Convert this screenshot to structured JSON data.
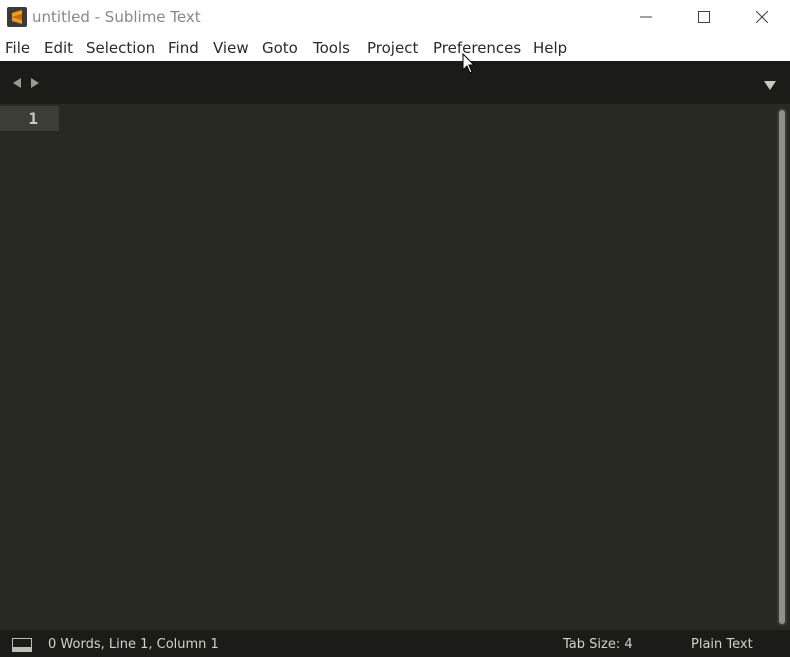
{
  "window": {
    "title": "untitled - Sublime Text",
    "app_icon": "sublime-text-logo",
    "controls": [
      "minimize-icon",
      "maximize-icon",
      "close-icon"
    ]
  },
  "menu": {
    "items": [
      {
        "label": "File"
      },
      {
        "label": "Edit"
      },
      {
        "label": "Selection"
      },
      {
        "label": "Find"
      },
      {
        "label": "View"
      },
      {
        "label": "Goto"
      },
      {
        "label": "Tools"
      },
      {
        "label": "Project"
      },
      {
        "label": "Preferences"
      },
      {
        "label": "Help"
      }
    ]
  },
  "tabbar": {
    "nav_left_icon": "triangle-left-icon",
    "nav_right_icon": "triangle-right-icon",
    "dropdown_icon": "triangle-down-icon"
  },
  "editor": {
    "line_numbers": [
      "1"
    ],
    "content": ""
  },
  "status": {
    "summary": "0 Words, Line 1, Column 1",
    "tab_size": "Tab Size: 4",
    "syntax": "Plain Text"
  },
  "colors": {
    "editor_bg": "#282923",
    "chrome_bg": "#1b1c18",
    "accent_logo": "#f29a1d"
  }
}
